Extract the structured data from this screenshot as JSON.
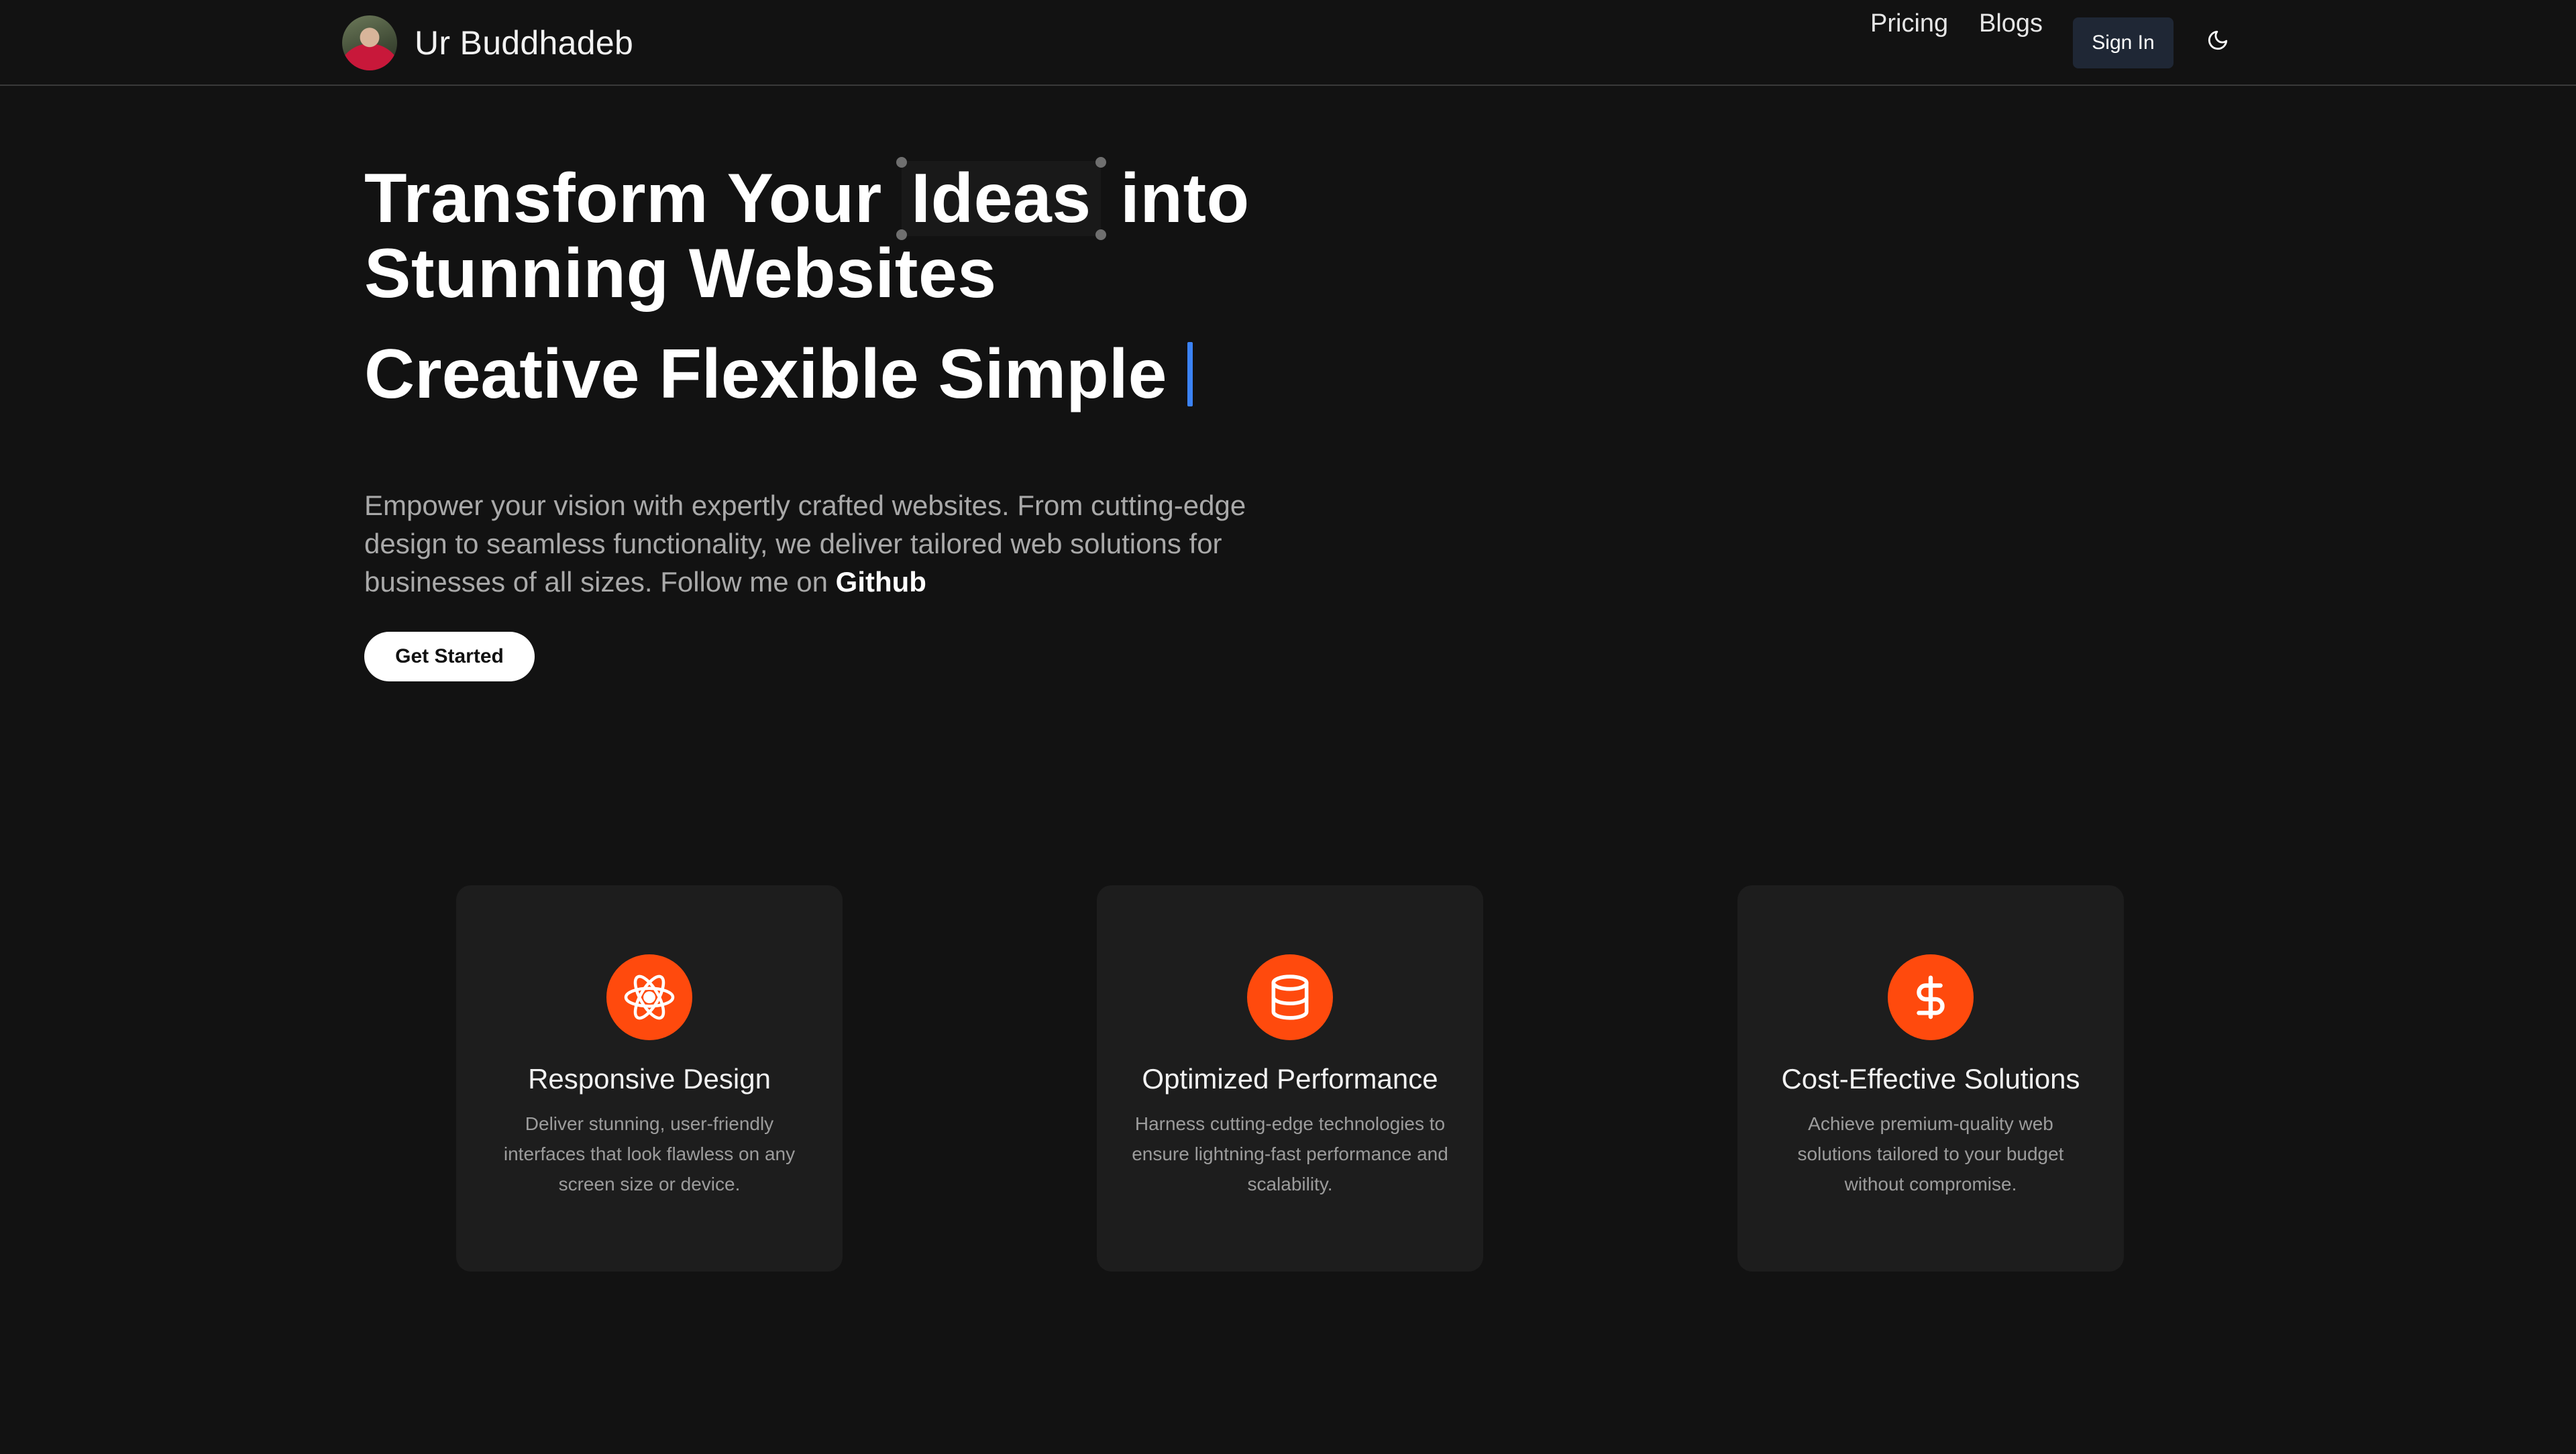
{
  "header": {
    "brand_name": "Ur Buddhadeb",
    "nav": {
      "pricing": "Pricing",
      "blogs": "Blogs",
      "sign_in": "Sign In"
    },
    "theme_icon": "moon-icon"
  },
  "hero": {
    "headline_part1": "Transform Your",
    "headline_highlight": "Ideas",
    "headline_part2": "into",
    "headline_line2": "Stunning Websites",
    "tagline": "Creative Flexible Simple",
    "description": "Empower your vision with expertly crafted websites. From cutting-edge design to seamless functionality, we deliver tailored web solutions for businesses of all sizes. Follow me on",
    "github_link": "Github",
    "cta_label": "Get Started"
  },
  "features": [
    {
      "icon": "atom-icon",
      "title": "Responsive Design",
      "text": "Deliver stunning, user-friendly interfaces that look flawless on any screen size or device."
    },
    {
      "icon": "database-icon",
      "title": "Optimized Performance",
      "text": "Harness cutting-edge technologies to ensure lightning-fast performance and scalability."
    },
    {
      "icon": "dollar-icon",
      "title": "Cost-Effective Solutions",
      "text": "Achieve premium-quality web solutions tailored to your budget without compromise."
    }
  ],
  "colors": {
    "background": "#121212",
    "card": "#1d1d1d",
    "accent": "#ff4a0d",
    "cursor": "#3b82f6",
    "sign_in_bg": "#1f2735"
  }
}
